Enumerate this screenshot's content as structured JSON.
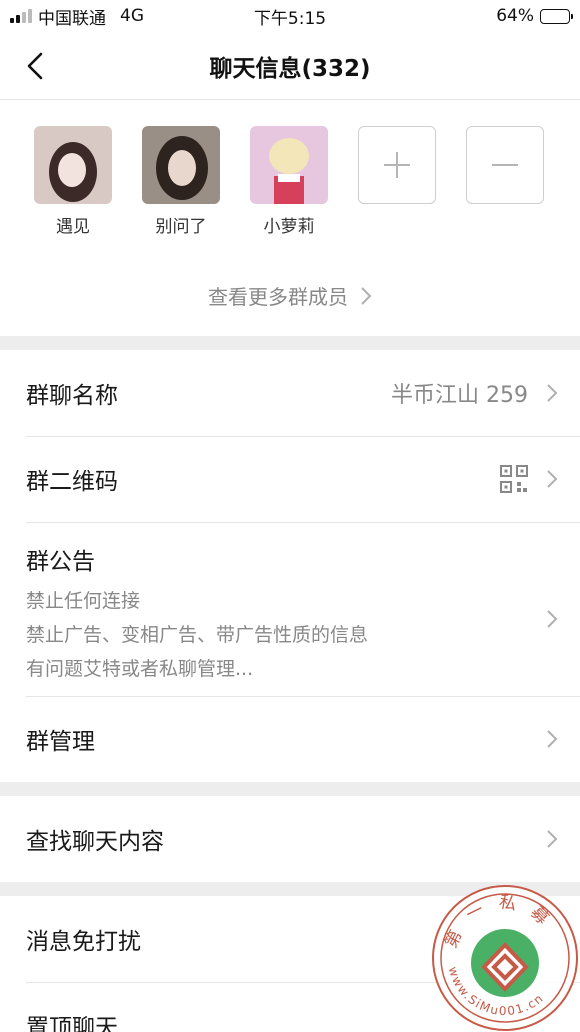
{
  "status_bar": {
    "carrier": "中国联通",
    "network": "4G",
    "time": "下午5:15",
    "battery_percent": "64%",
    "battery_level": 0.64
  },
  "nav": {
    "back_icon": "chevron-left-icon",
    "title": "聊天信息(332)"
  },
  "members": {
    "list": [
      {
        "name": "遇见",
        "avatar_colors": [
          "#d8c9c4",
          "#3b2a27",
          "#f2e3de"
        ]
      },
      {
        "name": "别问了",
        "avatar_colors": [
          "#9a8f86",
          "#2d2420",
          "#e7d7cc"
        ]
      },
      {
        "name": "小萝莉",
        "avatar_colors": [
          "#e7c6df",
          "#f3e6b8",
          "#d7405a"
        ]
      }
    ],
    "add_icon": "plus-icon",
    "remove_icon": "minus-icon",
    "more_label": "查看更多群成员"
  },
  "settings": {
    "group_name": {
      "label": "群聊名称",
      "value": "半币江山 259"
    },
    "qr_code": {
      "label": "群二维码",
      "icon": "qrcode-icon"
    },
    "notice": {
      "label": "群公告",
      "lines": [
        "禁止任何连接",
        "禁止广告、变相广告、带广告性质的信息",
        "有问题艾特或者私聊管理..."
      ]
    },
    "manage": {
      "label": "群管理"
    },
    "search": {
      "label": "查找聊天内容"
    },
    "mute": {
      "label": "消息免打扰"
    },
    "pin": {
      "label": "置顶聊天"
    }
  },
  "watermark": {
    "text_top": "第一私募",
    "text_bottom": "www.SiMu001.cn"
  },
  "colors": {
    "battery_fill": "#f7c325",
    "watermark_red": "#c65a47",
    "watermark_green": "#2aa24a"
  }
}
